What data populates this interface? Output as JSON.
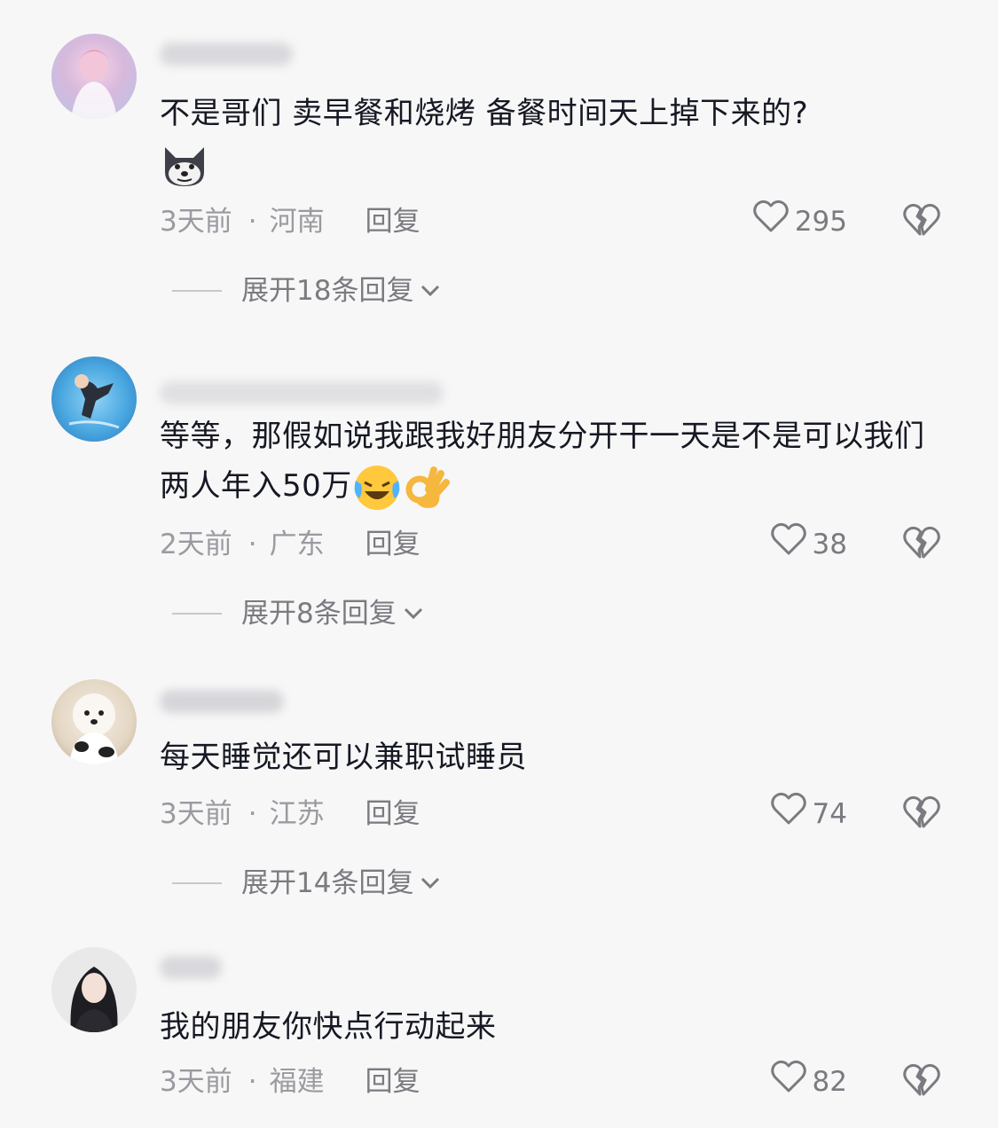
{
  "comments": [
    {
      "text": "不是哥们  卖早餐和烧烤  备餐时间天上掉下来的?",
      "time": "3天前",
      "dot": "·",
      "location": "河南",
      "reply_label": "回复",
      "likes": "295",
      "expand_label": "展开18条回复",
      "emoji": [
        "doge-emoji"
      ]
    },
    {
      "text": "等等，那假如说我跟我好朋友分开干一天是不是可以我们两人年入50万",
      "time": "2天前",
      "dot": "·",
      "location": "广东",
      "reply_label": "回复",
      "likes": "38",
      "expand_label": "展开8条回复",
      "emoji": [
        "laughing-tears-emoji",
        "ok-hand-emoji"
      ]
    },
    {
      "text": "每天睡觉还可以兼职试睡员",
      "time": "3天前",
      "dot": "·",
      "location": "江苏",
      "reply_label": "回复",
      "likes": "74",
      "expand_label": "展开14条回复"
    },
    {
      "text": "我的朋友你快点行动起来",
      "time": "3天前",
      "dot": "·",
      "location": "福建",
      "reply_label": "回复",
      "likes": "82"
    }
  ],
  "colors": {
    "text": "#161823",
    "meta": "#9a9aa0",
    "background": "#f7f7f7"
  },
  "icons": {
    "like": "heart-outline-icon",
    "dislike": "broken-heart-icon",
    "expand": "chevron-down-icon"
  }
}
